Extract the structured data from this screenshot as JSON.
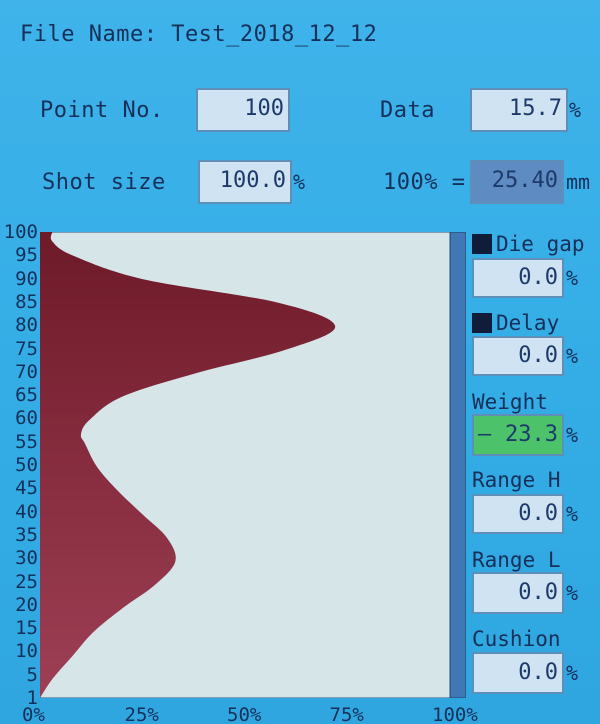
{
  "file_name": "File Name: Test_2018_12_12",
  "point_no": {
    "label": "Point No.",
    "value": "100"
  },
  "data": {
    "label": "Data",
    "value": "15.7",
    "unit": "%"
  },
  "shot_size": {
    "label": "Shot size",
    "value": "100.0",
    "unit": "%"
  },
  "ref": {
    "label": "100% =",
    "value": "25.40",
    "unit": "mm"
  },
  "side": {
    "die_gap": {
      "label": "Die gap",
      "value": "0.0",
      "unit": "%"
    },
    "delay": {
      "label": "Delay",
      "value": "0.0",
      "unit": "%"
    },
    "weight": {
      "label": "Weight",
      "sign": "–",
      "value": "23.3",
      "unit": "%"
    },
    "range_h": {
      "label": "Range H",
      "value": "0.0",
      "unit": "%"
    },
    "range_l": {
      "label": "Range L",
      "value": "0.0",
      "unit": "%"
    },
    "cushion": {
      "label": "Cushion",
      "value": "0.0",
      "unit": "%"
    }
  },
  "colors": {
    "fill": "#7a1e2d",
    "plot_bg": "#d6e6e8",
    "field": "#cfe3f2",
    "green": "#4cc36a",
    "accent": "#3fb3ea"
  },
  "chart_data": {
    "type": "area",
    "orientation": "horizontal",
    "y_ticks": [
      "100",
      "95",
      "90",
      "85",
      "80",
      "75",
      "70",
      "65",
      "60",
      "55",
      "50",
      "45",
      "40",
      "35",
      "30",
      "25",
      "20",
      "15",
      "10",
      "5",
      "1"
    ],
    "x_ticks": [
      "0%",
      "25%",
      "50%",
      "75%",
      "100%"
    ],
    "xlim": [
      0,
      100
    ],
    "ylim": [
      1,
      100
    ],
    "points": [
      {
        "y": 1,
        "x": 0
      },
      {
        "y": 5,
        "x": 3
      },
      {
        "y": 10,
        "x": 8
      },
      {
        "y": 15,
        "x": 13
      },
      {
        "y": 20,
        "x": 20
      },
      {
        "y": 25,
        "x": 28
      },
      {
        "y": 30,
        "x": 33
      },
      {
        "y": 35,
        "x": 31
      },
      {
        "y": 40,
        "x": 25
      },
      {
        "y": 45,
        "x": 19
      },
      {
        "y": 50,
        "x": 14
      },
      {
        "y": 55,
        "x": 11
      },
      {
        "y": 57,
        "x": 10
      },
      {
        "y": 60,
        "x": 12
      },
      {
        "y": 65,
        "x": 20
      },
      {
        "y": 70,
        "x": 38
      },
      {
        "y": 75,
        "x": 60
      },
      {
        "y": 80,
        "x": 72
      },
      {
        "y": 85,
        "x": 58
      },
      {
        "y": 90,
        "x": 25
      },
      {
        "y": 95,
        "x": 8
      },
      {
        "y": 98,
        "x": 3
      },
      {
        "y": 100,
        "x": 3
      }
    ]
  }
}
